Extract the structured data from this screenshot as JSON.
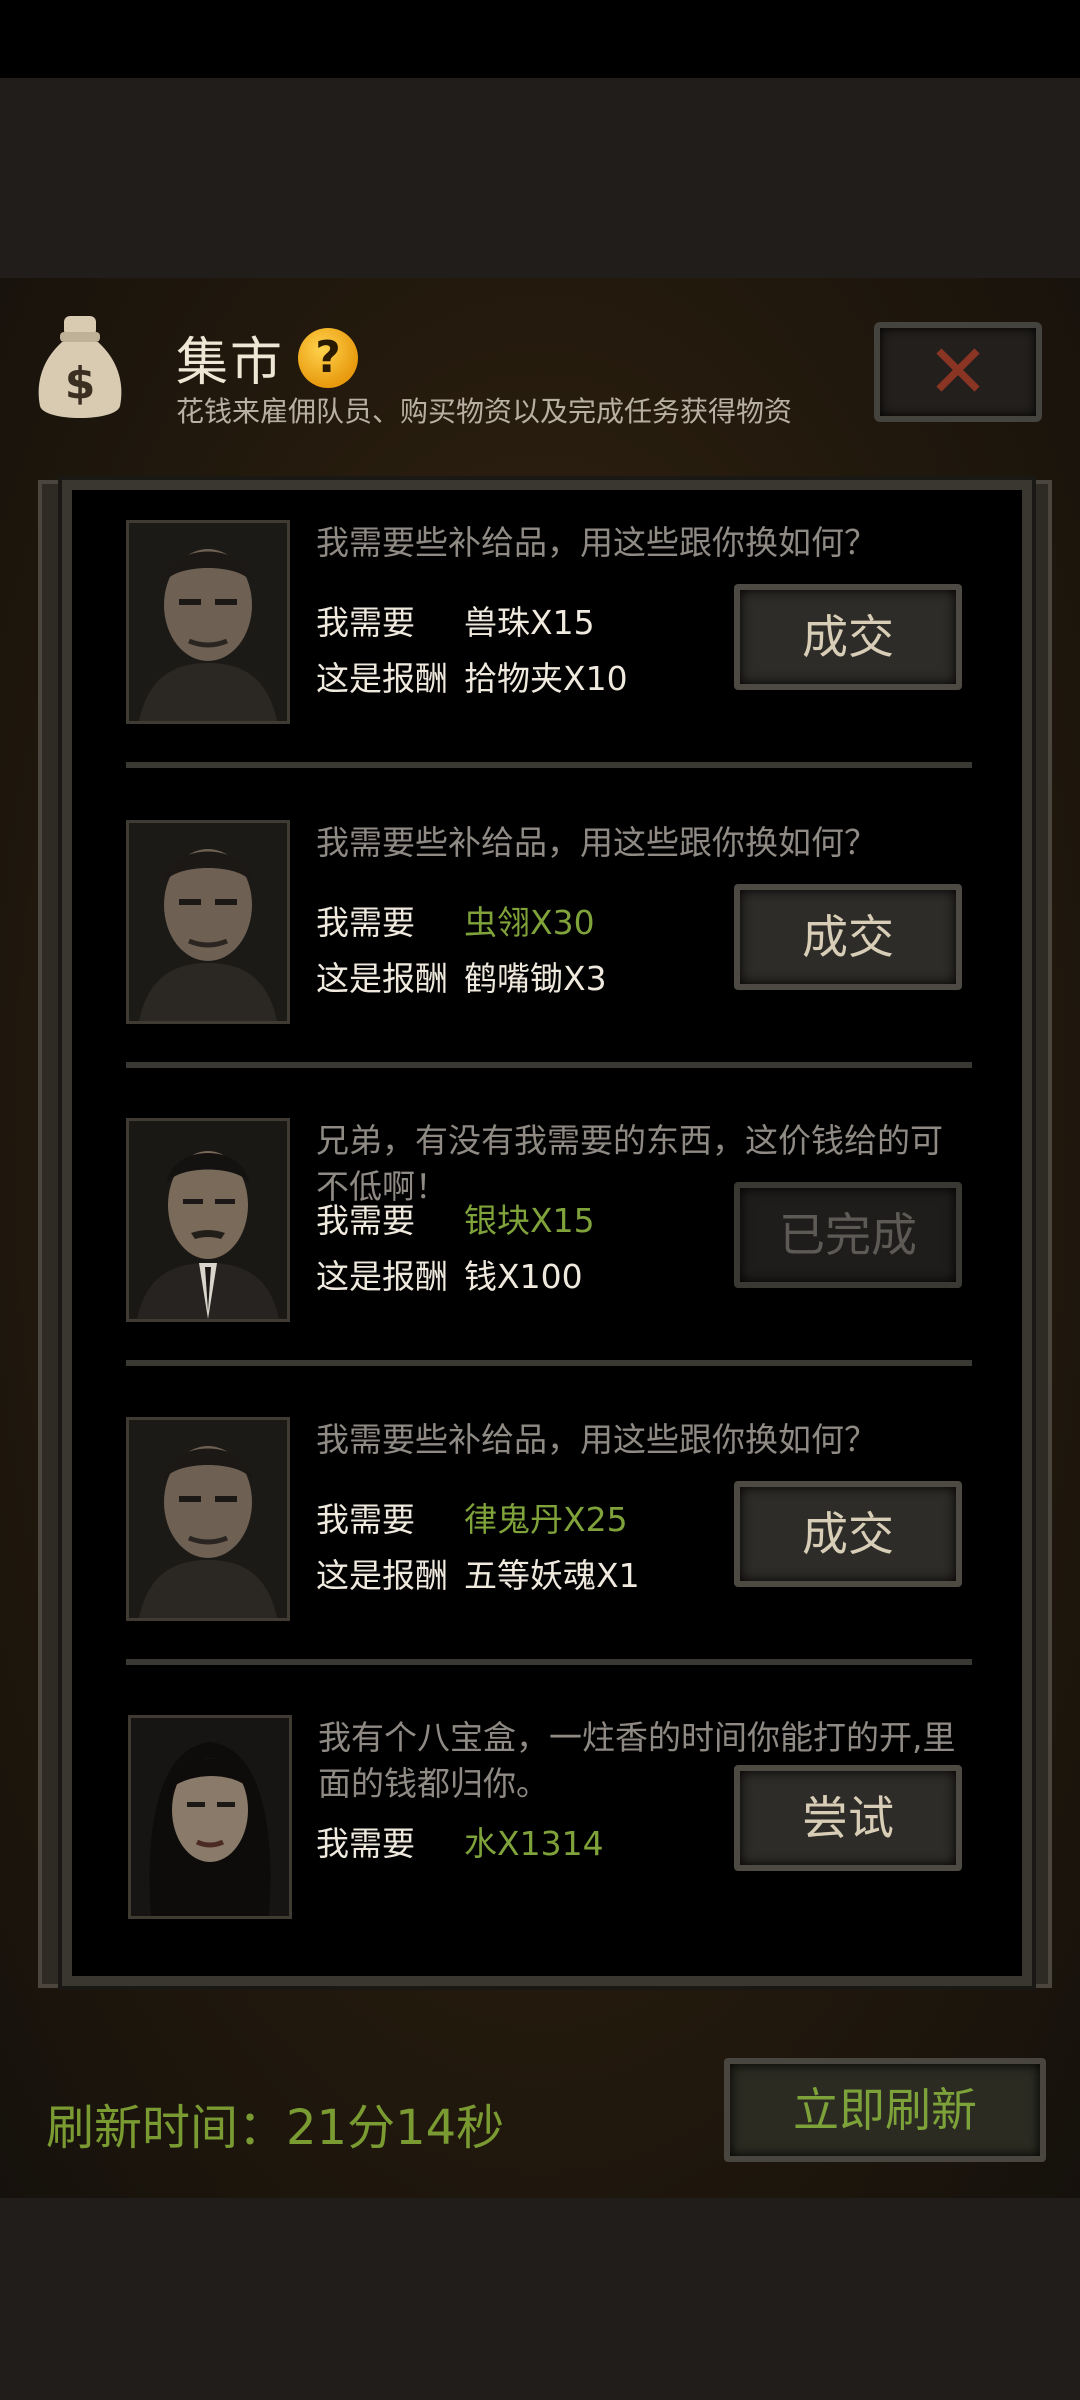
{
  "header": {
    "title": "集市",
    "help_icon": "question-icon",
    "subtitle": "花钱来雇佣队员、购买物资以及完成任务获得物资",
    "close_icon": "close-x-icon",
    "close_label": "✕"
  },
  "labels": {
    "need": "我需要",
    "reward": "这是报酬"
  },
  "trades": [
    {
      "quote": "我需要些补给品，用这些跟你换如何？",
      "need": "兽珠X15",
      "need_color": "white",
      "reward": "拾物夹X10",
      "button": "成交",
      "status": "available"
    },
    {
      "quote": "我需要些补给品，用这些跟你换如何？",
      "need": "虫翎X30",
      "need_color": "green",
      "reward": "鹤嘴锄X3",
      "button": "成交",
      "status": "available"
    },
    {
      "quote": "兄弟，有没有我需要的东西，这价钱给的可不低啊！",
      "need": "银块X15",
      "need_color": "green",
      "reward": "钱X100",
      "button": "已完成",
      "status": "completed"
    },
    {
      "quote": "我需要些补给品，用这些跟你换如何？",
      "need": "律鬼丹X25",
      "need_color": "green",
      "reward": "五等妖魂X1",
      "button": "成交",
      "status": "available"
    },
    {
      "quote": "我有个八宝盒，一炷香的时间你能打的开,里面的钱都归你。",
      "need": "水X1314",
      "need_color": "green",
      "reward": "",
      "button": "尝试",
      "status": "available"
    }
  ],
  "footer": {
    "refresh_time": "刷新时间：21分14秒",
    "refresh_button": "立即刷新"
  },
  "colors": {
    "accent_green": "#7fa23a",
    "close_red": "#8a3424",
    "text_light": "#efe9de",
    "text_muted": "#8f8a84"
  }
}
